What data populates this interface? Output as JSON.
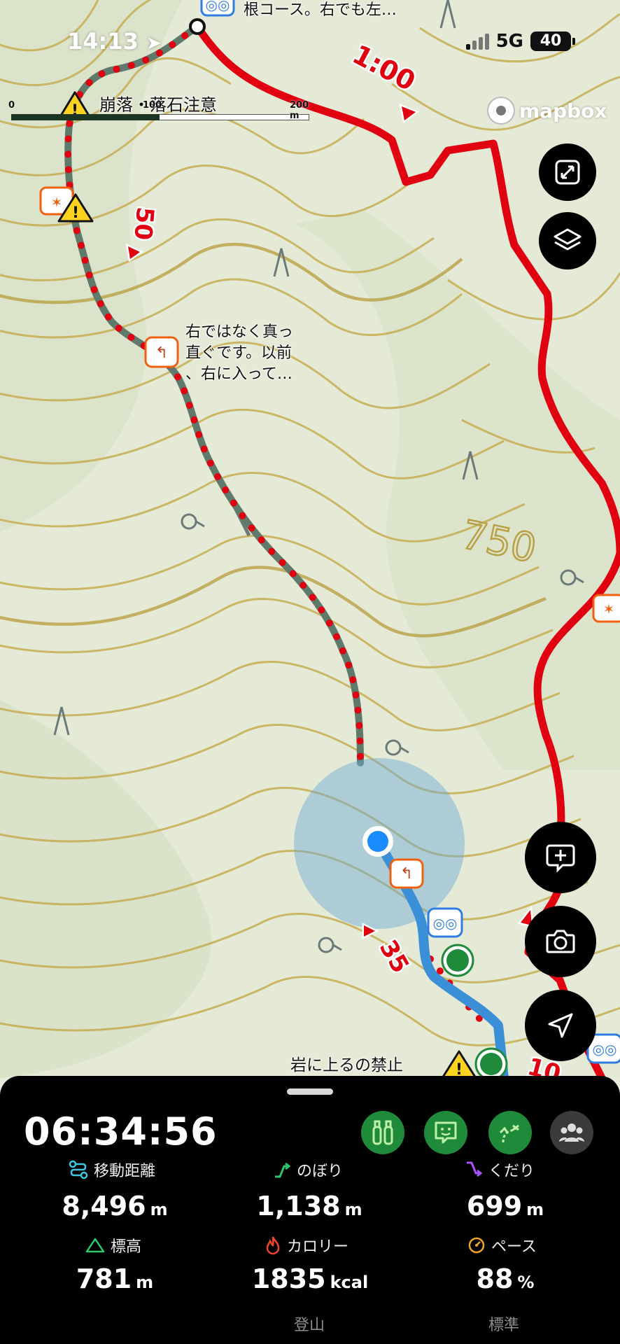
{
  "status_bar": {
    "time": "14:13",
    "network": "5G",
    "battery": "40"
  },
  "map": {
    "scale": {
      "ticks": [
        "0",
        "100",
        "200 m"
      ]
    },
    "attribution": "mapbox",
    "labels": {
      "top_route_note": "根コース。右でも左…",
      "warning_note": "崩落・落石注意",
      "middle_note_line1": "右ではなく真っ",
      "middle_note_line2": "直ぐです。以前",
      "middle_note_line3": "、右に入って…",
      "rock_warning": "岩に上るの禁止"
    },
    "time_markers": [
      "1:00",
      "50",
      "35",
      "10"
    ],
    "contour_label": "750",
    "colors": {
      "planned_route": "#e0000f",
      "track": "#3b8fd6",
      "user_location": "#1a8cff"
    },
    "controls": [
      "expand-icon",
      "layers-icon",
      "add-note-icon",
      "camera-icon",
      "locate-icon"
    ]
  },
  "panel": {
    "elapsed_time": "06:34:56",
    "actions": [
      "binoculars-icon",
      "face-icon",
      "route-icon",
      "group-icon"
    ],
    "stats": {
      "distance": {
        "label": "移動距離",
        "value": "8,496",
        "unit": "m"
      },
      "ascent": {
        "label": "のぼり",
        "value": "1,138",
        "unit": "m"
      },
      "descent": {
        "label": "くだり",
        "value": "699",
        "unit": "m"
      },
      "elevation": {
        "label": "標高",
        "value": "781",
        "unit": "m"
      },
      "calories": {
        "label": "カロリー",
        "value": "1835",
        "unit": "kcal",
        "note": "登山"
      },
      "pace": {
        "label": "ペース",
        "value": "88",
        "unit": "%",
        "note": "標準"
      }
    }
  }
}
